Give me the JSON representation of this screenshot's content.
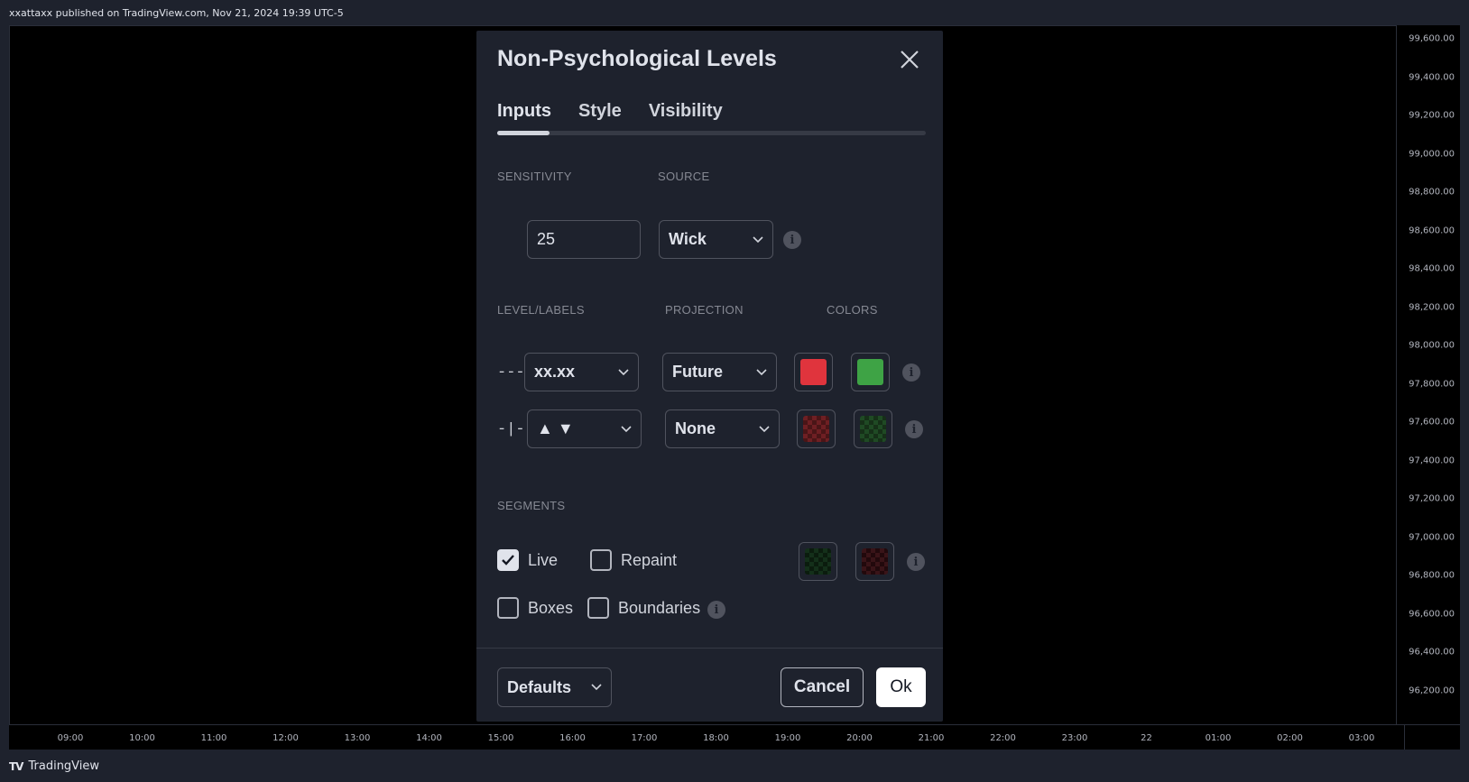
{
  "publisher": {
    "text": "xxattaxx published on TradingView.com, Nov 21, 2024 19:39 UTC-5"
  },
  "price_axis": [
    "99,600.00",
    "99,400.00",
    "99,200.00",
    "99,000.00",
    "98,800.00",
    "98,600.00",
    "98,400.00",
    "98,200.00",
    "98,000.00",
    "97,800.00",
    "97,600.00",
    "97,400.00",
    "97,200.00",
    "97,000.00",
    "96,800.00",
    "96,600.00",
    "96,400.00",
    "96,200.00"
  ],
  "time_axis": [
    "09:00",
    "10:00",
    "11:00",
    "12:00",
    "13:00",
    "14:00",
    "15:00",
    "16:00",
    "17:00",
    "18:00",
    "19:00",
    "20:00",
    "21:00",
    "22:00",
    "23:00",
    "22",
    "01:00",
    "02:00",
    "03:00"
  ],
  "brand": {
    "name": "TradingView",
    "logo": "TV"
  },
  "dialog": {
    "title": "Non-Psychological Levels",
    "tabs": [
      "Inputs",
      "Style",
      "Visibility"
    ],
    "active_tab": "Inputs",
    "labels": {
      "sensitivity": "SENSITIVITY",
      "source": "SOURCE",
      "level_labels": "LEVEL/LABELS",
      "projection": "PROJECTION",
      "colors": "COLORS",
      "segments": "SEGMENTS"
    },
    "sensitivity_value": "25",
    "source_value": "Wick",
    "row1": {
      "prefix": "---",
      "label_value": "xx.xx",
      "projection_value": "Future",
      "color_a": "#e0343d",
      "color_b": "#3ea345"
    },
    "row2": {
      "prefix": "-|-",
      "label_value": "▲ ▼",
      "projection_value": "None"
    },
    "segments": {
      "live": "Live",
      "repaint": "Repaint",
      "boxes": "Boxes",
      "boundaries": "Boundaries",
      "live_checked": true
    },
    "info_glyph": "i",
    "footer": {
      "defaults": "Defaults",
      "cancel": "Cancel",
      "ok": "Ok"
    }
  }
}
